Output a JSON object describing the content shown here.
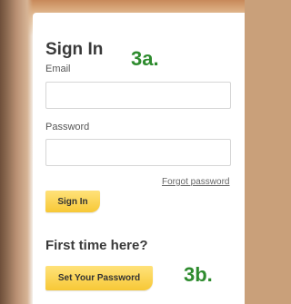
{
  "form": {
    "title": "Sign In",
    "email_label": "Email",
    "email_value": "",
    "password_label": "Password",
    "password_value": "",
    "forgot_link": "Forgot password",
    "signin_button": "Sign In"
  },
  "first_time": {
    "heading": "First time here?",
    "set_password_button": "Set Your Password"
  },
  "annotations": {
    "step_a": "3a.",
    "step_b": "3b."
  },
  "colors": {
    "button_gold": "#f7c836",
    "annotation_green": "#2e8b2e"
  }
}
